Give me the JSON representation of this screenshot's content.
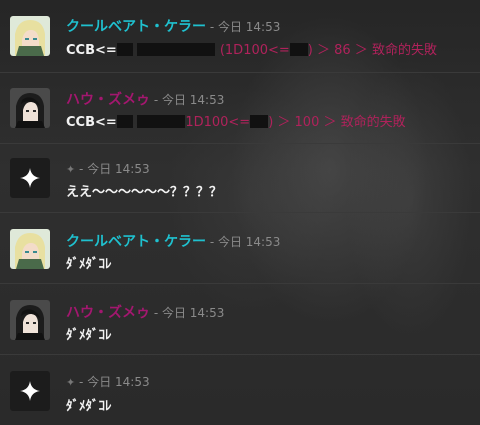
{
  "messages": [
    {
      "sender": "クールベアト・ケラー",
      "time": "- 今日 14:53",
      "prefix": "CCB<=",
      "tail_a": "(1D100<=",
      "tail_b": ") ＞ 86 ＞ 致命的失敗",
      "avatar": "blond-character-avatar"
    },
    {
      "sender": "ハウ・ズメゥ",
      "time": "- 今日 14:53",
      "prefix": "CCB<=",
      "tail_a": "1D100<=",
      "tail_b": ") ＞ 100 ＞ 致命的失敗",
      "avatar": "dark-haired-character-avatar"
    },
    {
      "sender_icon": "sparkle-icon",
      "time": "- 今日 14:53",
      "text": "ええ〜〜〜〜〜〜？？？？",
      "avatar": "sparkle-avatar"
    },
    {
      "sender": "クールベアト・ケラー",
      "time": "- 今日 14:53",
      "text": "ﾀﾞﾒﾀﾞｺﾚ",
      "avatar": "blond-character-avatar"
    },
    {
      "sender": "ハウ・ズメゥ",
      "time": "- 今日 14:53",
      "text": "ﾀﾞﾒﾀﾞｺﾚ",
      "avatar": "dark-haired-character-avatar"
    },
    {
      "sender_icon": "sparkle-icon",
      "time": "- 今日 14:53",
      "text": "ﾀﾞﾒﾀﾞｺﾚ",
      "avatar": "sparkle-avatar"
    }
  ],
  "colors": {
    "name_cyan": "#1fc1cf",
    "name_purple": "#a3176f",
    "roll_red": "#b0225b"
  }
}
